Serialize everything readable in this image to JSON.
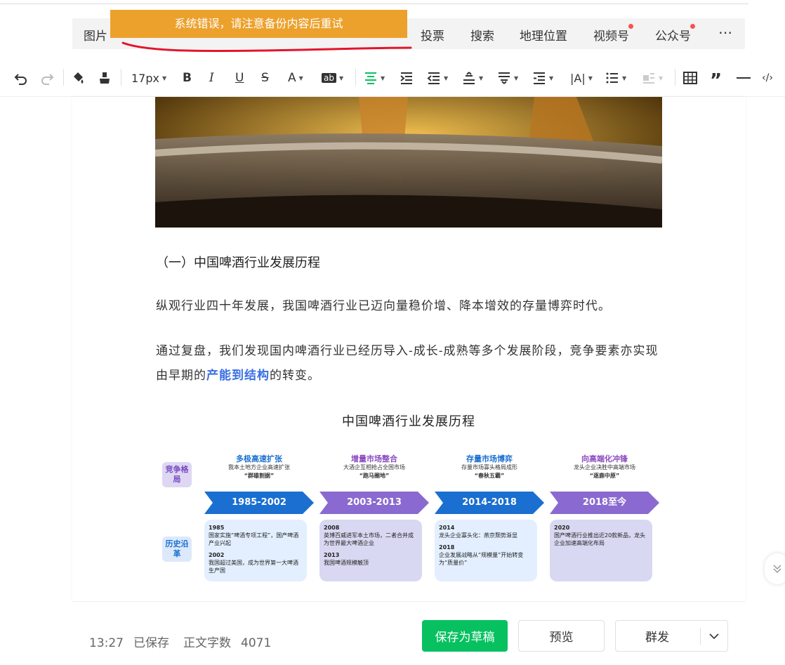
{
  "menu": {
    "items": [
      {
        "label": "图片",
        "dot": false
      },
      {
        "label": "投票",
        "dot": false
      },
      {
        "label": "搜索",
        "dot": false
      },
      {
        "label": "地理位置",
        "dot": false
      },
      {
        "label": "视频号",
        "dot": true
      },
      {
        "label": "公众号",
        "dot": true
      }
    ],
    "more_icon": "more-dots-icon"
  },
  "error_banner": "系统错误，请注意备份内容后重试",
  "toolbar": {
    "font_size": "17px",
    "icons": [
      "undo-icon",
      "redo-icon",
      "format-painter-icon",
      "clear-format-icon",
      "bold-icon",
      "italic-icon",
      "underline-icon",
      "strikethrough-icon",
      "font-color-icon",
      "background-color-icon",
      "align-center-icon",
      "indent-icon",
      "outdent-icon",
      "line-height-icon",
      "paragraph-spacing-icon",
      "text-indent-icon",
      "letter-spacing-icon",
      "list-icon",
      "float-icon",
      "table-icon",
      "quote-icon",
      "divider-icon",
      "code-icon"
    ]
  },
  "article": {
    "section_title": "（一）中国啤酒行业发展历程",
    "para1": "纵观行业四十年发展，我国啤酒行业已迈向量稳价增、降本增效的存量博弈时代。",
    "para2_before": "通过复盘，我们发现国内啤酒行业已经历导入-成长-成熟等多个发展阶段，竞争要素亦实现由早期的",
    "para2_highlight": "产能到结构",
    "para2_after": "的转变。",
    "figure_title": "中国啤酒行业发展历程"
  },
  "timeline": {
    "side_labels": {
      "top": "竞争格局",
      "bottom": "历史沿革"
    },
    "columns": [
      {
        "head1": "多极高速扩张",
        "head2": "我本土地方企业高速扩张",
        "head3": "“群雄割据”",
        "period": "1985-2002",
        "color": "#1a6fd0",
        "head_color": "#1a6fd0",
        "box_color": "#e3efff",
        "events": [
          {
            "year": "1985",
            "text": "国家实施“啤酒专项工程”，国产啤酒产业兴起"
          },
          {
            "year": "2002",
            "text": "我国超过美国，成为世界第一大啤酒生产国"
          }
        ]
      },
      {
        "head1": "增量市场整合",
        "head2": "大酒企互相抢占全国市场",
        "head3": "“跑马圈地”",
        "period": "2003-2013",
        "color": "#8a6ad0",
        "head_color": "#8a4ac0",
        "box_color": "#d8d8f2",
        "events": [
          {
            "year": "2008",
            "text": "英博百威进军本土市场，二者合并成为世界最大啤酒企业"
          },
          {
            "year": "2013",
            "text": "我国啤酒规模触顶"
          }
        ]
      },
      {
        "head1": "存量市场博弈",
        "head2": "存量市场寡头格局成形",
        "head3": "“春秋五霸”",
        "period": "2014-2018",
        "color": "#1a6fd0",
        "head_color": "#1a6fd0",
        "box_color": "#e3efff",
        "events": [
          {
            "year": "2014",
            "text": "龙头企业寡头化：燕京颓势渐显"
          },
          {
            "year": "2018",
            "text": "企业发展战略从“规模量”开始转变为“质量价”"
          }
        ]
      },
      {
        "head1": "向高端化冲锋",
        "head2": "龙头企业决胜中高端市场",
        "head3": "“逐鹿中原”",
        "period": "2018至今",
        "color": "#8a6ad0",
        "head_color": "#8a4ac0",
        "box_color": "#d8d8f2",
        "events": [
          {
            "year": "2020",
            "text": "国产啤酒行业推出近20款新品，龙头企业加速高端化布局"
          }
        ]
      }
    ]
  },
  "bottombar": {
    "time": "13:27",
    "saved": "已保存",
    "word_count_label": "正文字数",
    "word_count": "4071",
    "save_draft": "保存为草稿",
    "preview": "预览",
    "mass_send": "群发"
  }
}
